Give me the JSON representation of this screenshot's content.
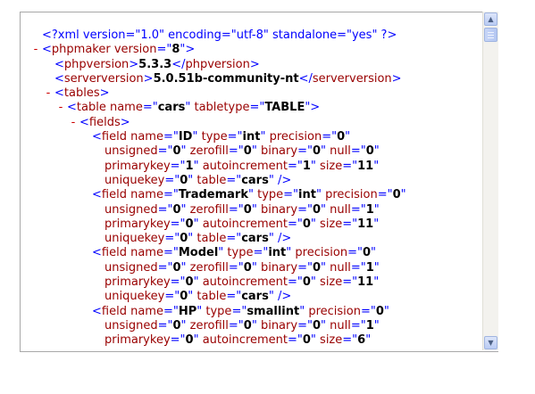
{
  "xml_declaration": "<?xml version=\"1.0\" encoding=\"utf-8\" standalone=\"yes\" ?>",
  "lines": [
    {
      "indent": 0,
      "toggle": "",
      "pi": true,
      "parts": [
        [
          "pi",
          "<?xml version=\"1.0\" encoding=\"utf-8\" standalone=\"yes\" ?>"
        ]
      ]
    },
    {
      "indent": 0,
      "toggle": "-",
      "parts": [
        [
          "punct",
          "<"
        ],
        [
          "tag",
          "phpmaker "
        ],
        [
          "attr",
          "version"
        ],
        [
          "punct",
          "=\""
        ],
        [
          "txt",
          "8"
        ],
        [
          "punct",
          "\">"
        ]
      ]
    },
    {
      "indent": 1,
      "toggle": "",
      "parts": [
        [
          "punct",
          "<"
        ],
        [
          "tag",
          "phpversion"
        ],
        [
          "punct",
          ">"
        ],
        [
          "txt",
          "5.3.3"
        ],
        [
          "punct",
          "</"
        ],
        [
          "tag",
          "phpversion"
        ],
        [
          "punct",
          ">"
        ]
      ]
    },
    {
      "indent": 1,
      "toggle": "",
      "parts": [
        [
          "punct",
          "<"
        ],
        [
          "tag",
          "serverversion"
        ],
        [
          "punct",
          ">"
        ],
        [
          "txt",
          "5.0.51b-community-nt"
        ],
        [
          "punct",
          "</"
        ],
        [
          "tag",
          "serverversion"
        ],
        [
          "punct",
          ">"
        ]
      ]
    },
    {
      "indent": 1,
      "toggle": "-",
      "parts": [
        [
          "punct",
          "<"
        ],
        [
          "tag",
          "tables"
        ],
        [
          "punct",
          ">"
        ]
      ]
    },
    {
      "indent": 2,
      "toggle": "-",
      "parts": [
        [
          "punct",
          "<"
        ],
        [
          "tag",
          "table "
        ],
        [
          "attr",
          "name"
        ],
        [
          "punct",
          "=\""
        ],
        [
          "txt",
          "cars"
        ],
        [
          "punct",
          "\" "
        ],
        [
          "attr",
          "tabletype"
        ],
        [
          "punct",
          "=\""
        ],
        [
          "txt",
          "TABLE"
        ],
        [
          "punct",
          "\">"
        ]
      ]
    },
    {
      "indent": 3,
      "toggle": "-",
      "parts": [
        [
          "punct",
          "<"
        ],
        [
          "tag",
          "fields"
        ],
        [
          "punct",
          ">"
        ]
      ]
    },
    {
      "indent": 4,
      "toggle": "",
      "parts": [
        [
          "punct",
          "<"
        ],
        [
          "tag",
          "field "
        ],
        [
          "attr",
          "name"
        ],
        [
          "punct",
          "=\""
        ],
        [
          "txt",
          "ID"
        ],
        [
          "punct",
          "\" "
        ],
        [
          "attr",
          "type"
        ],
        [
          "punct",
          "=\""
        ],
        [
          "txt",
          "int"
        ],
        [
          "punct",
          "\" "
        ],
        [
          "attr",
          "precision"
        ],
        [
          "punct",
          "=\""
        ],
        [
          "txt",
          "0"
        ],
        [
          "punct",
          "\""
        ]
      ]
    },
    {
      "indent": 5,
      "toggle": "",
      "parts": [
        [
          "attr",
          "unsigned"
        ],
        [
          "punct",
          "=\""
        ],
        [
          "txt",
          "0"
        ],
        [
          "punct",
          "\" "
        ],
        [
          "attr",
          "zerofill"
        ],
        [
          "punct",
          "=\""
        ],
        [
          "txt",
          "0"
        ],
        [
          "punct",
          "\" "
        ],
        [
          "attr",
          "binary"
        ],
        [
          "punct",
          "=\""
        ],
        [
          "txt",
          "0"
        ],
        [
          "punct",
          "\" "
        ],
        [
          "attr",
          "null"
        ],
        [
          "punct",
          "=\""
        ],
        [
          "txt",
          "0"
        ],
        [
          "punct",
          "\""
        ]
      ]
    },
    {
      "indent": 5,
      "toggle": "",
      "parts": [
        [
          "attr",
          "primarykey"
        ],
        [
          "punct",
          "=\""
        ],
        [
          "txt",
          "1"
        ],
        [
          "punct",
          "\" "
        ],
        [
          "attr",
          "autoincrement"
        ],
        [
          "punct",
          "=\""
        ],
        [
          "txt",
          "1"
        ],
        [
          "punct",
          "\" "
        ],
        [
          "attr",
          "size"
        ],
        [
          "punct",
          "=\""
        ],
        [
          "txt",
          "11"
        ],
        [
          "punct",
          "\""
        ]
      ]
    },
    {
      "indent": 5,
      "toggle": "",
      "parts": [
        [
          "attr",
          "uniquekey"
        ],
        [
          "punct",
          "=\""
        ],
        [
          "txt",
          "0"
        ],
        [
          "punct",
          "\" "
        ],
        [
          "attr",
          "table"
        ],
        [
          "punct",
          "=\""
        ],
        [
          "txt",
          "cars"
        ],
        [
          "punct",
          "\" />"
        ]
      ]
    },
    {
      "indent": 4,
      "toggle": "",
      "parts": [
        [
          "punct",
          "<"
        ],
        [
          "tag",
          "field "
        ],
        [
          "attr",
          "name"
        ],
        [
          "punct",
          "=\""
        ],
        [
          "txt",
          "Trademark"
        ],
        [
          "punct",
          "\" "
        ],
        [
          "attr",
          "type"
        ],
        [
          "punct",
          "=\""
        ],
        [
          "txt",
          "int"
        ],
        [
          "punct",
          "\" "
        ],
        [
          "attr",
          "precision"
        ],
        [
          "punct",
          "=\""
        ],
        [
          "txt",
          "0"
        ],
        [
          "punct",
          "\""
        ]
      ]
    },
    {
      "indent": 5,
      "toggle": "",
      "parts": [
        [
          "attr",
          "unsigned"
        ],
        [
          "punct",
          "=\""
        ],
        [
          "txt",
          "0"
        ],
        [
          "punct",
          "\" "
        ],
        [
          "attr",
          "zerofill"
        ],
        [
          "punct",
          "=\""
        ],
        [
          "txt",
          "0"
        ],
        [
          "punct",
          "\" "
        ],
        [
          "attr",
          "binary"
        ],
        [
          "punct",
          "=\""
        ],
        [
          "txt",
          "0"
        ],
        [
          "punct",
          "\" "
        ],
        [
          "attr",
          "null"
        ],
        [
          "punct",
          "=\""
        ],
        [
          "txt",
          "1"
        ],
        [
          "punct",
          "\""
        ]
      ]
    },
    {
      "indent": 5,
      "toggle": "",
      "parts": [
        [
          "attr",
          "primarykey"
        ],
        [
          "punct",
          "=\""
        ],
        [
          "txt",
          "0"
        ],
        [
          "punct",
          "\" "
        ],
        [
          "attr",
          "autoincrement"
        ],
        [
          "punct",
          "=\""
        ],
        [
          "txt",
          "0"
        ],
        [
          "punct",
          "\" "
        ],
        [
          "attr",
          "size"
        ],
        [
          "punct",
          "=\""
        ],
        [
          "txt",
          "11"
        ],
        [
          "punct",
          "\""
        ]
      ]
    },
    {
      "indent": 5,
      "toggle": "",
      "parts": [
        [
          "attr",
          "uniquekey"
        ],
        [
          "punct",
          "=\""
        ],
        [
          "txt",
          "0"
        ],
        [
          "punct",
          "\" "
        ],
        [
          "attr",
          "table"
        ],
        [
          "punct",
          "=\""
        ],
        [
          "txt",
          "cars"
        ],
        [
          "punct",
          "\" />"
        ]
      ]
    },
    {
      "indent": 4,
      "toggle": "",
      "parts": [
        [
          "punct",
          "<"
        ],
        [
          "tag",
          "field "
        ],
        [
          "attr",
          "name"
        ],
        [
          "punct",
          "=\""
        ],
        [
          "txt",
          "Model"
        ],
        [
          "punct",
          "\" "
        ],
        [
          "attr",
          "type"
        ],
        [
          "punct",
          "=\""
        ],
        [
          "txt",
          "int"
        ],
        [
          "punct",
          "\" "
        ],
        [
          "attr",
          "precision"
        ],
        [
          "punct",
          "=\""
        ],
        [
          "txt",
          "0"
        ],
        [
          "punct",
          "\""
        ]
      ]
    },
    {
      "indent": 5,
      "toggle": "",
      "parts": [
        [
          "attr",
          "unsigned"
        ],
        [
          "punct",
          "=\""
        ],
        [
          "txt",
          "0"
        ],
        [
          "punct",
          "\" "
        ],
        [
          "attr",
          "zerofill"
        ],
        [
          "punct",
          "=\""
        ],
        [
          "txt",
          "0"
        ],
        [
          "punct",
          "\" "
        ],
        [
          "attr",
          "binary"
        ],
        [
          "punct",
          "=\""
        ],
        [
          "txt",
          "0"
        ],
        [
          "punct",
          "\" "
        ],
        [
          "attr",
          "null"
        ],
        [
          "punct",
          "=\""
        ],
        [
          "txt",
          "1"
        ],
        [
          "punct",
          "\""
        ]
      ]
    },
    {
      "indent": 5,
      "toggle": "",
      "parts": [
        [
          "attr",
          "primarykey"
        ],
        [
          "punct",
          "=\""
        ],
        [
          "txt",
          "0"
        ],
        [
          "punct",
          "\" "
        ],
        [
          "attr",
          "autoincrement"
        ],
        [
          "punct",
          "=\""
        ],
        [
          "txt",
          "0"
        ],
        [
          "punct",
          "\" "
        ],
        [
          "attr",
          "size"
        ],
        [
          "punct",
          "=\""
        ],
        [
          "txt",
          "11"
        ],
        [
          "punct",
          "\""
        ]
      ]
    },
    {
      "indent": 5,
      "toggle": "",
      "parts": [
        [
          "attr",
          "uniquekey"
        ],
        [
          "punct",
          "=\""
        ],
        [
          "txt",
          "0"
        ],
        [
          "punct",
          "\" "
        ],
        [
          "attr",
          "table"
        ],
        [
          "punct",
          "=\""
        ],
        [
          "txt",
          "cars"
        ],
        [
          "punct",
          "\" />"
        ]
      ]
    },
    {
      "indent": 4,
      "toggle": "",
      "parts": [
        [
          "punct",
          "<"
        ],
        [
          "tag",
          "field "
        ],
        [
          "attr",
          "name"
        ],
        [
          "punct",
          "=\""
        ],
        [
          "txt",
          "HP"
        ],
        [
          "punct",
          "\" "
        ],
        [
          "attr",
          "type"
        ],
        [
          "punct",
          "=\""
        ],
        [
          "txt",
          "smallint"
        ],
        [
          "punct",
          "\" "
        ],
        [
          "attr",
          "precision"
        ],
        [
          "punct",
          "=\""
        ],
        [
          "txt",
          "0"
        ],
        [
          "punct",
          "\""
        ]
      ]
    },
    {
      "indent": 5,
      "toggle": "",
      "parts": [
        [
          "attr",
          "unsigned"
        ],
        [
          "punct",
          "=\""
        ],
        [
          "txt",
          "0"
        ],
        [
          "punct",
          "\" "
        ],
        [
          "attr",
          "zerofill"
        ],
        [
          "punct",
          "=\""
        ],
        [
          "txt",
          "0"
        ],
        [
          "punct",
          "\" "
        ],
        [
          "attr",
          "binary"
        ],
        [
          "punct",
          "=\""
        ],
        [
          "txt",
          "0"
        ],
        [
          "punct",
          "\" "
        ],
        [
          "attr",
          "null"
        ],
        [
          "punct",
          "=\""
        ],
        [
          "txt",
          "1"
        ],
        [
          "punct",
          "\""
        ]
      ]
    },
    {
      "indent": 5,
      "toggle": "",
      "parts": [
        [
          "attr",
          "primarykey"
        ],
        [
          "punct",
          "=\""
        ],
        [
          "txt",
          "0"
        ],
        [
          "punct",
          "\" "
        ],
        [
          "attr",
          "autoincrement"
        ],
        [
          "punct",
          "=\""
        ],
        [
          "txt",
          "0"
        ],
        [
          "punct",
          "\" "
        ],
        [
          "attr",
          "size"
        ],
        [
          "punct",
          "=\""
        ],
        [
          "txt",
          "6"
        ],
        [
          "punct",
          "\""
        ]
      ]
    }
  ],
  "scrollbar": {
    "up_icon": "scroll-up-arrow-icon",
    "down_icon": "scroll-down-arrow-icon",
    "up_glyph": "▲",
    "down_glyph": "▼"
  }
}
